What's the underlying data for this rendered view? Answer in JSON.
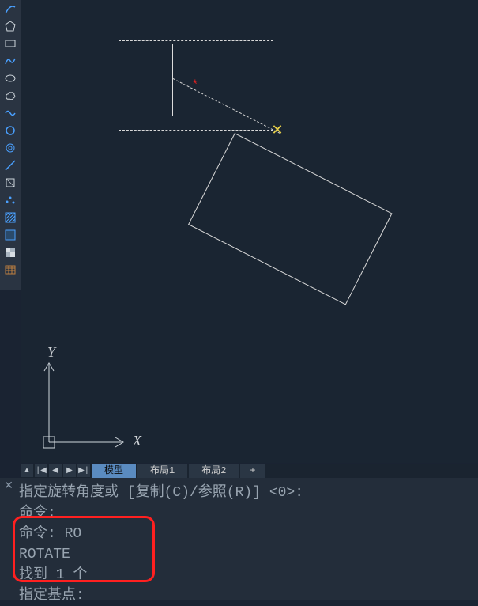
{
  "toolbar": {
    "items": [
      {
        "name": "arc-tool",
        "color": "#4aa0ff"
      },
      {
        "name": "polygon-tool",
        "color": "#cfd6dc"
      },
      {
        "name": "rectangle-tool",
        "color": "#cfd6dc"
      },
      {
        "name": "spline-tool",
        "color": "#4aa0ff"
      },
      {
        "name": "ellipse-tool",
        "color": "#cfd6dc"
      },
      {
        "name": "revcloud-tool",
        "color": "#cfd6dc"
      },
      {
        "name": "wave-tool",
        "color": "#4aa0ff"
      },
      {
        "name": "circle-tool",
        "color": "#4aa0ff"
      },
      {
        "name": "donut-tool",
        "color": "#4aa0ff"
      },
      {
        "name": "construction-line-tool",
        "color": "#4aa0ff"
      },
      {
        "name": "region-tool",
        "color": "#cfd6dc"
      },
      {
        "name": "point-tool",
        "color": "#4aa0ff"
      },
      {
        "name": "hatch-tool",
        "color": "#4aa0ff"
      },
      {
        "name": "gradient-tool",
        "color": "#4aa0ff"
      },
      {
        "name": "fill-tool",
        "color": "#cfd6dc"
      },
      {
        "name": "table-tool",
        "color": "#a05820"
      }
    ]
  },
  "ucs": {
    "x_label": "X",
    "y_label": "Y"
  },
  "tabs": {
    "model": "模型",
    "layout1": "布局1",
    "layout2": "布局2",
    "plus": "+"
  },
  "command": {
    "line1": "指定旋转角度或 [复制(C)/参照(R)] <0>:",
    "line2": "命令:",
    "line3": "命令: RO",
    "line4": "ROTATE",
    "line5": "找到 1 个",
    "line6": "指定基点:"
  }
}
